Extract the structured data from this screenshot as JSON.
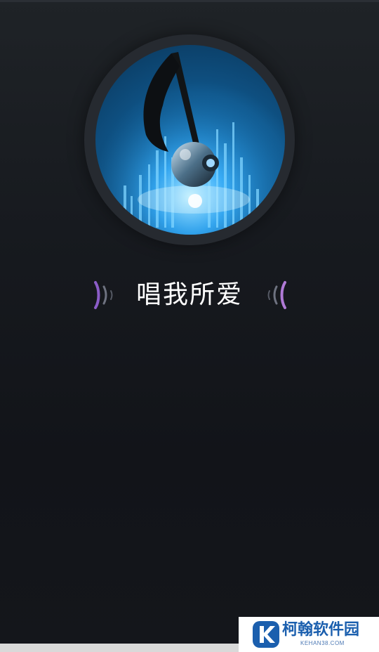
{
  "app": {
    "title": "唱我所爱",
    "accent_left_wave": "#8b5cc7",
    "accent_right_wave": "#b07ad6",
    "background": "#14171c"
  },
  "album_art": {
    "icon": "music-note-icon"
  },
  "watermark": {
    "name": "柯翰软件园",
    "domain": "KEHAN38.COM",
    "logo_letter": "K",
    "color": "#1b5fae"
  }
}
